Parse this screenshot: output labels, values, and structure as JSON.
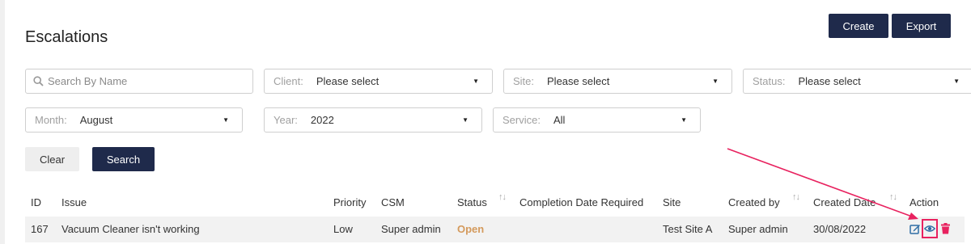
{
  "page": {
    "title": "Escalations"
  },
  "toolbar": {
    "create_label": "Create",
    "export_label": "Export"
  },
  "filters": {
    "search_placeholder": "Search By Name",
    "client": {
      "label": "Client:",
      "value": "Please select"
    },
    "site": {
      "label": "Site:",
      "value": "Please select"
    },
    "status": {
      "label": "Status:",
      "value": "Please select"
    },
    "month": {
      "label": "Month:",
      "value": "August"
    },
    "year": {
      "label": "Year:",
      "value": "2022"
    },
    "service": {
      "label": "Service:",
      "value": "All"
    },
    "arrow_glyph": "▼",
    "clear_label": "Clear",
    "search_label": "Search"
  },
  "table": {
    "headers": {
      "id": "ID",
      "issue": "Issue",
      "priority": "Priority",
      "csm": "CSM",
      "status": "Status",
      "completion": "Completion Date Required",
      "site": "Site",
      "created_by": "Created by",
      "created_date": "Created Date",
      "action": "Action"
    },
    "sort_glyph": "↑↓",
    "rows": [
      {
        "id": "167",
        "issue": "Vacuum Cleaner isn't working",
        "priority": "Low",
        "csm": "Super admin",
        "status": "Open",
        "completion": "",
        "site": "Test Site A",
        "created_by": "Super admin",
        "created_date": "30/08/2022"
      }
    ]
  },
  "icons": {
    "edit": "edit-icon",
    "view": "eye-icon",
    "delete": "trash-icon",
    "search": "search-icon"
  },
  "colors": {
    "primary": "#1f2a4b",
    "open_status": "#d49a5c",
    "annotation": "#e8225f",
    "delete": "#e8225f",
    "edit": "#2e6da4"
  }
}
